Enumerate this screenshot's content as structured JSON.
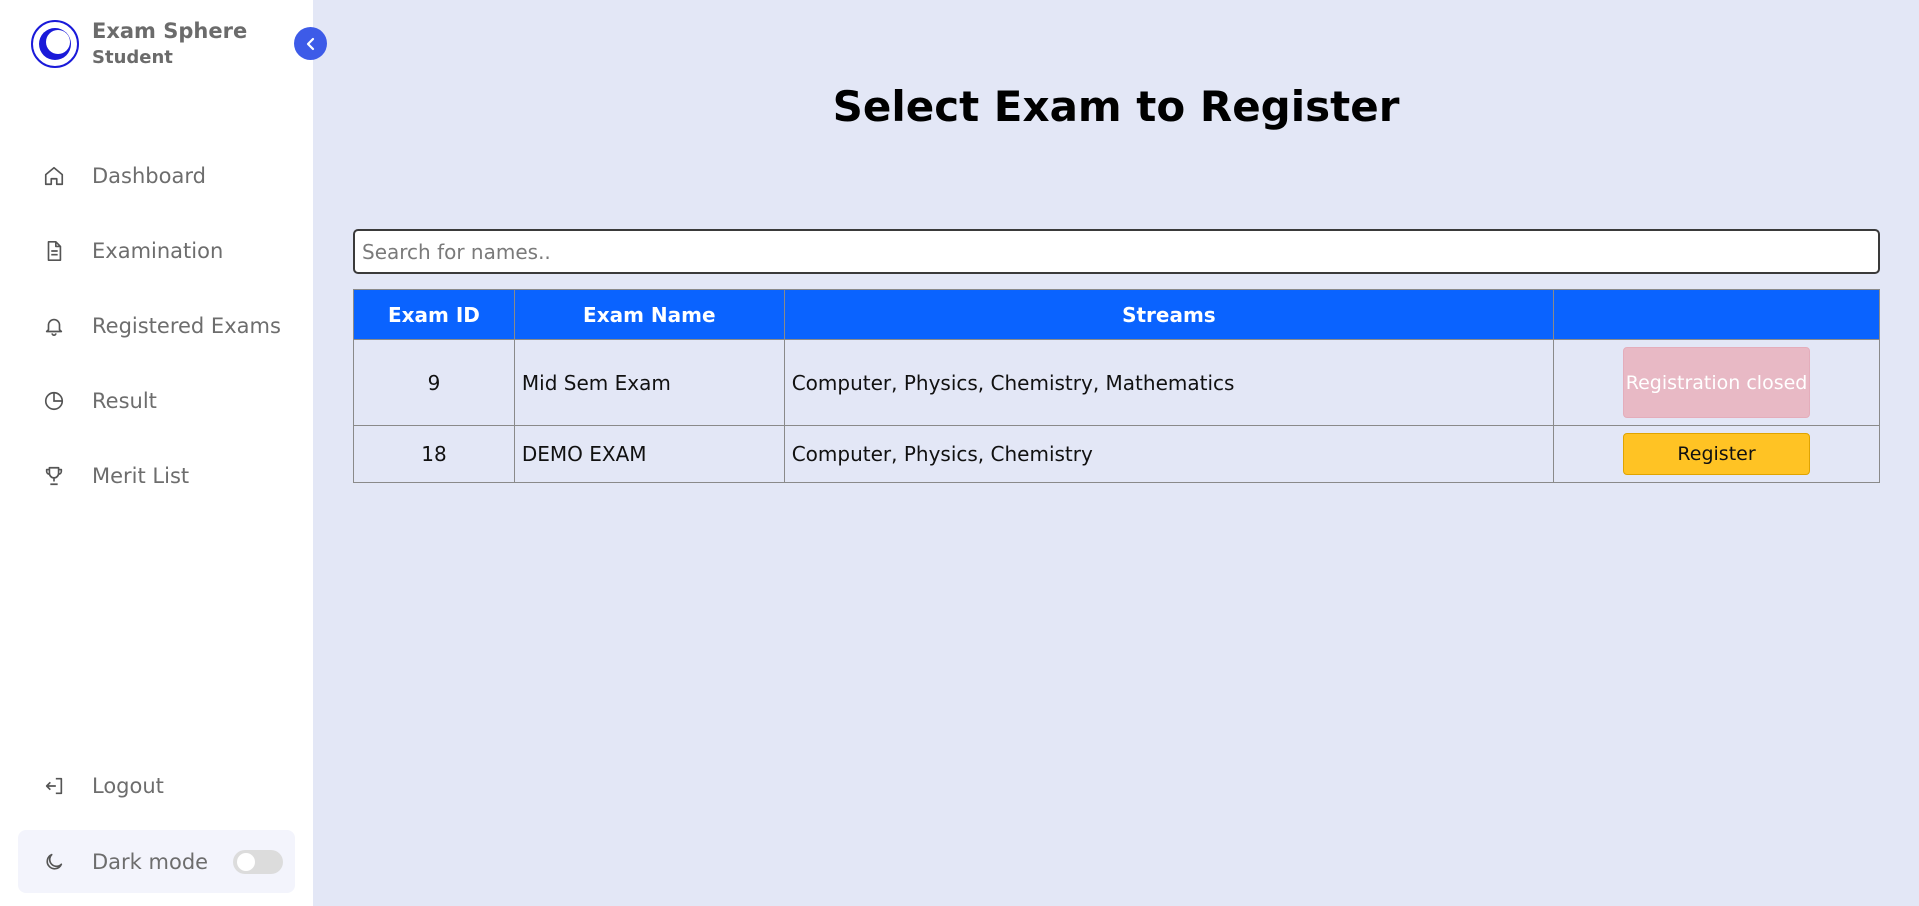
{
  "sidebar": {
    "brand_title": "Exam Sphere",
    "brand_subtitle": "Student",
    "items": [
      {
        "label": "Dashboard",
        "icon": "home-icon"
      },
      {
        "label": "Examination",
        "icon": "document-icon"
      },
      {
        "label": "Registered Exams",
        "icon": "bell-icon"
      },
      {
        "label": "Result",
        "icon": "clock-icon"
      },
      {
        "label": "Merit List",
        "icon": "trophy-icon"
      }
    ],
    "logout_label": "Logout",
    "dark_mode_label": "Dark mode",
    "dark_mode_enabled": false
  },
  "main": {
    "title": "Select Exam to Register",
    "search_placeholder": "Search for names..",
    "table": {
      "headers": [
        "Exam ID",
        "Exam Name",
        "Streams",
        ""
      ],
      "rows": [
        {
          "id": "9",
          "name": "Mid Sem Exam",
          "streams": "Computer, Physics, Chemistry, Mathematics",
          "action": "Registration closed",
          "action_enabled": false
        },
        {
          "id": "18",
          "name": "DEMO EXAM",
          "streams": "Computer, Physics, Chemistry",
          "action": "Register",
          "action_enabled": true
        }
      ]
    }
  },
  "colors": {
    "accent": "#0a63ff",
    "background": "#e3e7f6",
    "register_button": "#ffc324",
    "closed_button": "#e8b9c5"
  }
}
